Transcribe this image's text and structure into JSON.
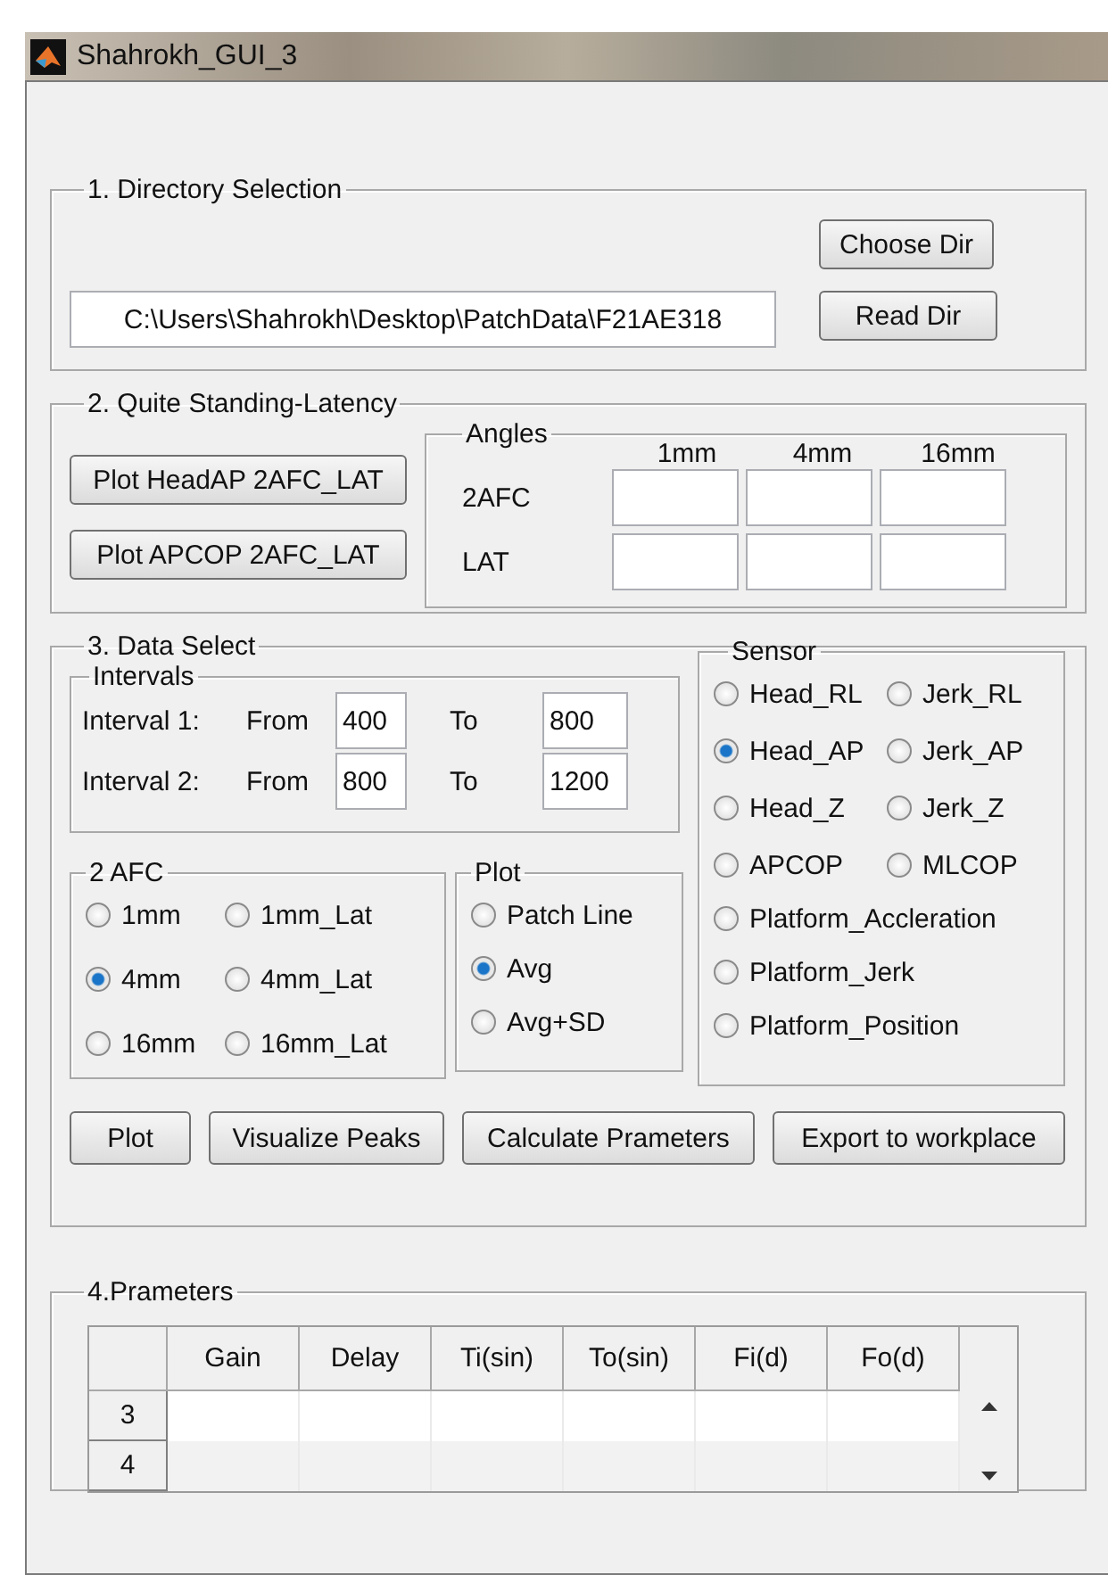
{
  "window": {
    "title": "Shahrokh_GUI_3"
  },
  "directory": {
    "legend": "1. Directory Selection",
    "path": "C:\\Users\\Shahrokh\\Desktop\\PatchData\\F21AE318",
    "buttons": [
      "Choose Dir",
      "Read Dir"
    ]
  },
  "latency": {
    "legend": "2. Quite Standing-Latency",
    "buttons": [
      "Plot HeadAP 2AFC_LAT",
      "Plot APCOP 2AFC_LAT"
    ],
    "angles": {
      "legend": "Angles",
      "columns": [
        "1mm",
        "4mm",
        "16mm"
      ],
      "rows": [
        "2AFC",
        "LAT"
      ]
    }
  },
  "data_select": {
    "legend": "3. Data Select",
    "intervals": {
      "legend": "Intervals",
      "rows": [
        {
          "label": "Interval 1:",
          "from_label": "From",
          "from": "400",
          "to_label": "To",
          "to": "800"
        },
        {
          "label": "Interval 2:",
          "from_label": "From",
          "from": "800",
          "to_label": "To",
          "to": "1200"
        }
      ]
    },
    "afc": {
      "legend": "2 AFC",
      "options": [
        {
          "label": "1mm",
          "selected": false
        },
        {
          "label": "1mm_Lat",
          "selected": false
        },
        {
          "label": "4mm",
          "selected": true
        },
        {
          "label": "4mm_Lat",
          "selected": false
        },
        {
          "label": "16mm",
          "selected": false
        },
        {
          "label": "16mm_Lat",
          "selected": false
        }
      ]
    },
    "plot": {
      "legend": "Plot",
      "options": [
        {
          "label": "Patch Line",
          "selected": false
        },
        {
          "label": "Avg",
          "selected": true
        },
        {
          "label": "Avg+SD",
          "selected": false
        }
      ]
    },
    "sensor": {
      "legend": "Sensor",
      "grid_options": [
        {
          "label": "Head_RL",
          "selected": false
        },
        {
          "label": "Jerk_RL",
          "selected": false
        },
        {
          "label": "Head_AP",
          "selected": true
        },
        {
          "label": "Jerk_AP",
          "selected": false
        },
        {
          "label": "Head_Z",
          "selected": false
        },
        {
          "label": "Jerk_Z",
          "selected": false
        },
        {
          "label": "APCOP",
          "selected": false
        },
        {
          "label": "MLCOP",
          "selected": false
        }
      ],
      "list_options": [
        {
          "label": "Platform_Accleration",
          "selected": false
        },
        {
          "label": "Platform_Jerk",
          "selected": false
        },
        {
          "label": "Platform_Position",
          "selected": false
        }
      ]
    },
    "buttons": [
      "Plot",
      "Visualize Peaks",
      "Calculate Prameters",
      "Export to workplace"
    ]
  },
  "parameters": {
    "legend": "4.Prameters",
    "table": {
      "columns": [
        "Gain",
        "Delay",
        "Ti(sin)",
        "To(sin)",
        "Fi(d)",
        "Fo(d)"
      ],
      "rows": [
        "3",
        "4"
      ]
    }
  }
}
